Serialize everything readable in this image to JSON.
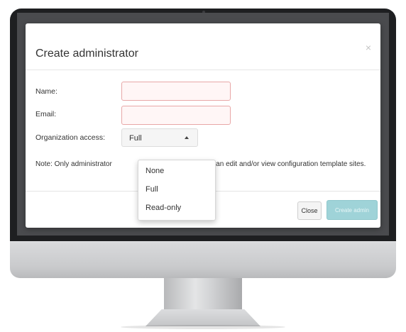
{
  "modal": {
    "title": "Create administrator",
    "close_glyph": "×"
  },
  "form": {
    "name_label": "Name:",
    "email_label": "Email:",
    "org_access_label": "Organization access:",
    "org_access_value": "Full",
    "note_before": "Note: Only administrator",
    "note_after": "cess can edit and/or view configuration template sites."
  },
  "dropdown": {
    "options": [
      "None",
      "Full",
      "Read-only"
    ]
  },
  "footer": {
    "close_label": "Close",
    "create_label": "Create admin"
  },
  "icons": {
    "dialog_close": "close-icon",
    "select_caret": "caret-up-icon"
  },
  "colors": {
    "invalid_field_bg": "#fff6f6",
    "invalid_field_border": "#e8a7a7",
    "primary_disabled": "#9fd3d8"
  }
}
